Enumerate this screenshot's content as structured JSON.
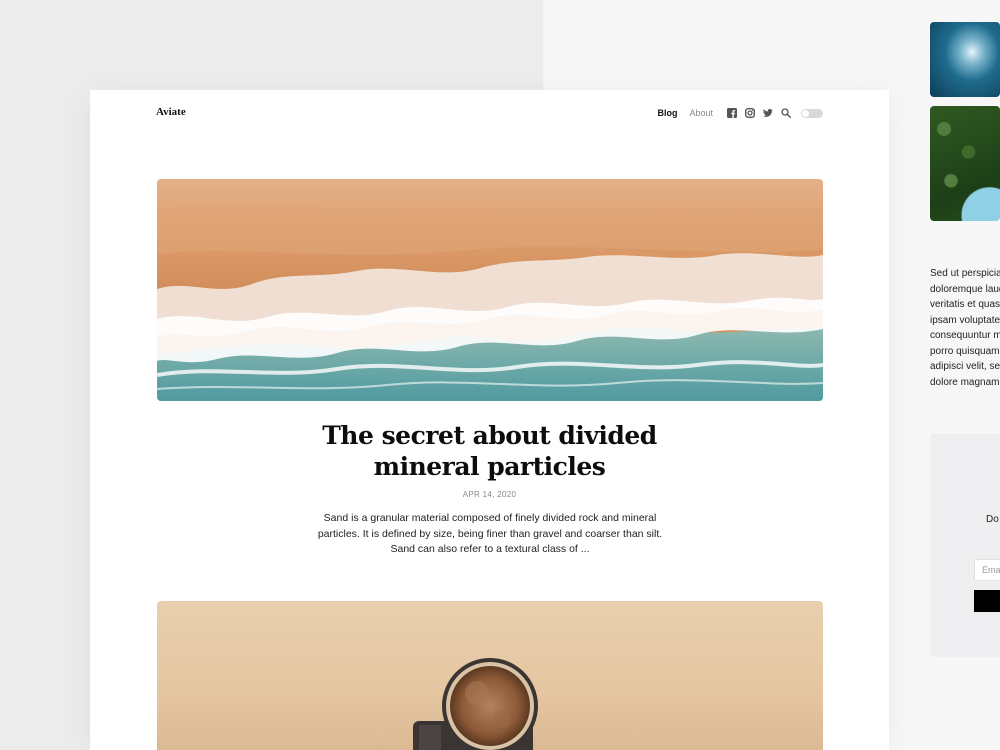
{
  "background_page": {
    "text_lines": [
      "Sed ut perspiciatis",
      "doloremque laudantium",
      "veritatis et quasi",
      "ipsam voluptatem",
      "consequuntur magni",
      "porro quisquam",
      "adipisci velit, sed",
      "dolore magnam"
    ],
    "newsletter": {
      "text": "Do",
      "email_placeholder": "Ema"
    }
  },
  "header": {
    "logo": "Aviate",
    "nav": {
      "blog": "Blog",
      "about": "About"
    },
    "icons": [
      "facebook-icon",
      "instagram-icon",
      "twitter-icon",
      "search-icon"
    ]
  },
  "post": {
    "title_line1": "The secret about divided",
    "title_line2": "mineral particles",
    "date": "APR 14, 2020",
    "excerpt_line1": "Sand is a granular material composed of finely divided rock and mineral",
    "excerpt_line2": "particles. It is defined by size, being finer than gravel and coarser than silt.",
    "excerpt_line3": "Sand can also refer to a textural class of ..."
  },
  "colors": {
    "sand": "#d9955f",
    "sea": "#5e9fa3",
    "foam": "#ffffff",
    "text_dark": "#0d0d0d"
  }
}
